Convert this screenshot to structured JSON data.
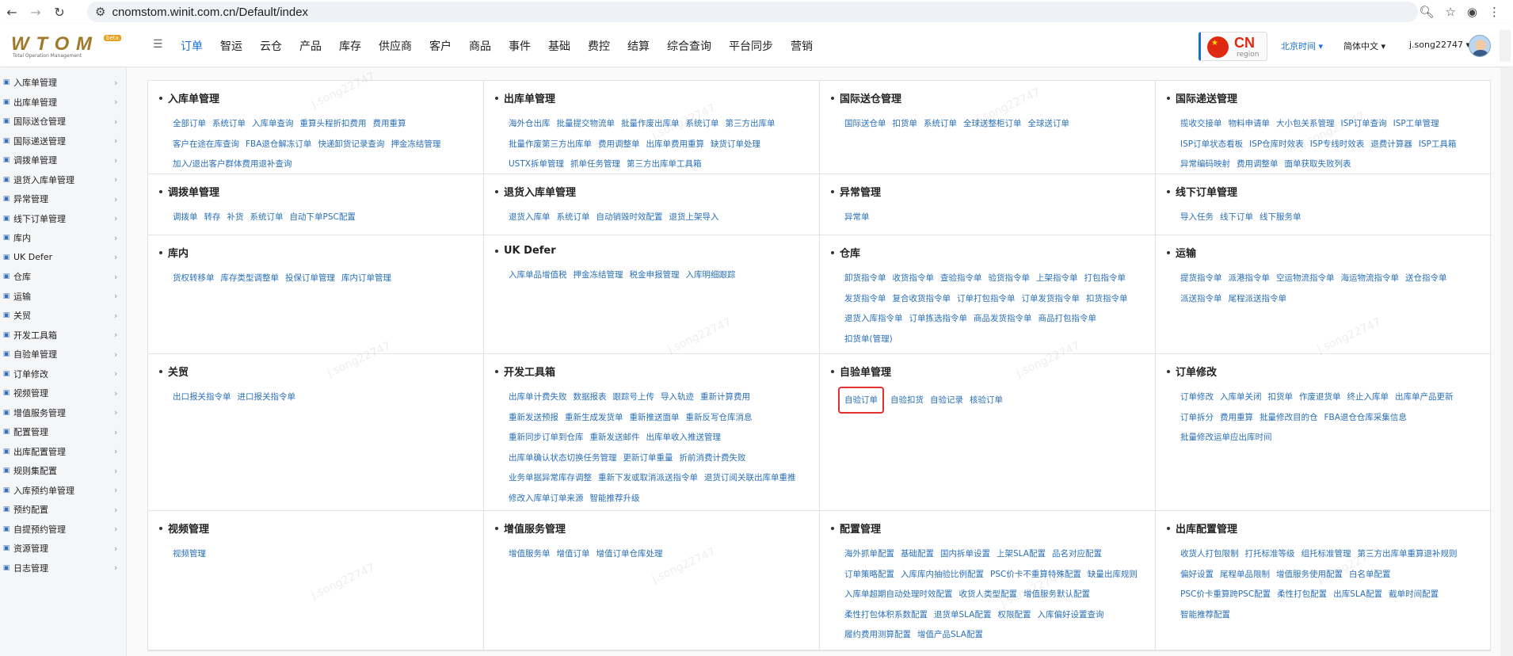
{
  "browser": {
    "url": "cnomstom.winit.com.cn/Default/index",
    "back_icon": "arrow-left-icon",
    "forward_icon": "arrow-right-icon",
    "reload_icon": "reload-icon"
  },
  "header": {
    "logo_text": "W T O M",
    "logo_sub": "Total Operation Management",
    "logo_badge": "beta",
    "top_menu": [
      "订单",
      "智运",
      "云仓",
      "产品",
      "库存",
      "供应商",
      "客户",
      "商品",
      "事件",
      "基础",
      "费控",
      "结算",
      "综合查询",
      "平台同步",
      "营销"
    ],
    "active_menu": "订单",
    "region_code": "CN",
    "region_label": "region",
    "timezone": "北京时间",
    "language": "简体中文",
    "user": "j.song22747",
    "accent_color": "#1a6fd6"
  },
  "sidebar": {
    "items": [
      "入库单管理",
      "出库单管理",
      "国际送仓管理",
      "国际递送管理",
      "调拨单管理",
      "退货入库单管理",
      "异常管理",
      "线下订单管理",
      "库内",
      "UK Defer",
      "仓库",
      "运输",
      "关贸",
      "开发工具箱",
      "自验单管理",
      "订单修改",
      "视频管理",
      "增值服务管理",
      "配置管理",
      "出库配置管理",
      "规则集配置",
      "入库预约单管理",
      "预约配置",
      "自提预约管理",
      "资源管理",
      "日志管理"
    ]
  },
  "cards": [
    {
      "title": "入库单管理",
      "links": [
        "全部订单",
        "系统订单",
        "入库单查询",
        "重算头程折扣费用",
        "费用重算",
        "客户在途在库查询",
        "FBA退仓解冻订单",
        "快递卸货记录查询",
        "押金冻结管理",
        "加入/退出客户群体费用退补查询"
      ]
    },
    {
      "title": "出库单管理",
      "links": [
        "海外仓出库",
        "批量提交物流单",
        "批量作废出库单",
        "系统订单",
        "第三方出库单",
        "批量作废第三方出库单",
        "费用调整单",
        "出库单费用重算",
        "缺货订单处理",
        "USTX拆单管理",
        "抓单任务管理",
        "第三方出库单工具箱"
      ]
    },
    {
      "title": "国际送仓管理",
      "links": [
        "国际送仓单",
        "扣货单",
        "系统订单",
        "全球送整柜订单",
        "全球送订单"
      ]
    },
    {
      "title": "国际递送管理",
      "links": [
        "揽收交接单",
        "物料申请单",
        "大小包关系管理",
        "ISP订单查询",
        "ISP工单管理",
        "ISP订单状态看板",
        "ISP仓库时效表",
        "ISP专线时效表",
        "退费计算器",
        "ISP工具箱",
        "异常编码映射",
        "费用调整单",
        "面单获取失败列表"
      ]
    },
    {
      "title": "调拨单管理",
      "links": [
        "调拨单",
        "转存",
        "补货",
        "系统订单",
        "自动下单PSC配置"
      ]
    },
    {
      "title": "退货入库单管理",
      "links": [
        "退货入库单",
        "系统订单",
        "自动销毁时效配置",
        "退货上架导入"
      ]
    },
    {
      "title": "异常管理",
      "links": [
        "异常单"
      ]
    },
    {
      "title": "线下订单管理",
      "links": [
        "导入任务",
        "线下订单",
        "线下服务单"
      ]
    },
    {
      "title": "库内",
      "links": [
        "货权转移单",
        "库存类型调整单",
        "投保订单管理",
        "库内订单管理"
      ]
    },
    {
      "title": "UK Defer",
      "links": [
        "入库单品增值税",
        "押金冻结管理",
        "税金申报管理",
        "入库明细跟踪"
      ]
    },
    {
      "title": "仓库",
      "links": [
        "卸货指令单",
        "收货指令单",
        "查验指令单",
        "验货指令单",
        "上架指令单",
        "打包指令单",
        "发货指令单",
        "复合收货指令单",
        "订单打包指令单",
        "订单发货指令单",
        "扣货指令单",
        "退货入库指令单",
        "订单拣选指令单",
        "商品发货指令单",
        "商品打包指令单",
        "扣货单(管理)"
      ]
    },
    {
      "title": "运输",
      "links": [
        "提货指令单",
        "派港指令单",
        "空运物流指令单",
        "海运物流指令单",
        "送仓指令单",
        "派送指令单",
        "尾程派送指令单"
      ]
    },
    {
      "title": "关贸",
      "links": [
        "出口报关指令单",
        "进口报关指令单"
      ]
    },
    {
      "title": "开发工具箱",
      "links": [
        "出库单计费失败",
        "数据报表",
        "跟踪号上传",
        "导入轨迹",
        "重新计算费用",
        "重新发送预报",
        "重新生成发货单",
        "重新推送面单",
        "重新反写仓库消息",
        "重新同步订单到仓库",
        "重新发送邮件",
        "出库单收入推送管理",
        "出库单确认状态切换任务管理",
        "更新订单重量",
        "折前消费计费失败",
        "业务单据异常库存调整",
        "重新下发或取消派送指令单",
        "退货订阅关联出库单重推",
        "修改入库单订单来源",
        "智能推荐升级"
      ]
    },
    {
      "title": "自验单管理",
      "links": [
        "自验订单",
        "自验扣货",
        "自验记录",
        "核验订单"
      ],
      "highlight": "自验订单"
    },
    {
      "title": "订单修改",
      "links": [
        "订单修改",
        "入库单关闭",
        "扣货单",
        "作废退货单",
        "终止入库单",
        "出库单产品更新",
        "订单拆分",
        "费用重算",
        "批量修改目的仓",
        "FBA退仓仓库采集信息",
        "批量修改运单应出库时间"
      ]
    },
    {
      "title": "视频管理",
      "links": [
        "视频管理"
      ]
    },
    {
      "title": "增值服务管理",
      "links": [
        "增值服务单",
        "增值订单",
        "增值订单仓库处理"
      ]
    },
    {
      "title": "配置管理",
      "links": [
        "海外抓单配置",
        "基础配置",
        "国内拆单设置",
        "上架SLA配置",
        "品名对应配置",
        "订单策略配置",
        "入库库内抽验比例配置",
        "PSC价卡不重算特殊配置",
        "缺量出库规则",
        "入库单超期自动处理时效配置",
        "收货人类型配置",
        "增值服务默认配置",
        "柔性打包体积系数配置",
        "退货单SLA配置",
        "权限配置",
        "入库偏好设置查询",
        "履约费用测算配置",
        "增值产品SLA配置"
      ]
    },
    {
      "title": "出库配置管理",
      "links": [
        "收货人打包限制",
        "打托标准等级",
        "组托标准管理",
        "第三方出库单重算退补规则",
        "偏好设置",
        "尾程单品限制",
        "增值服务使用配置",
        "白名单配置",
        "PSC价卡重算跨PSC配置",
        "柔性打包配置",
        "出库SLA配置",
        "截单时间配置",
        "智能推荐配置"
      ]
    }
  ]
}
